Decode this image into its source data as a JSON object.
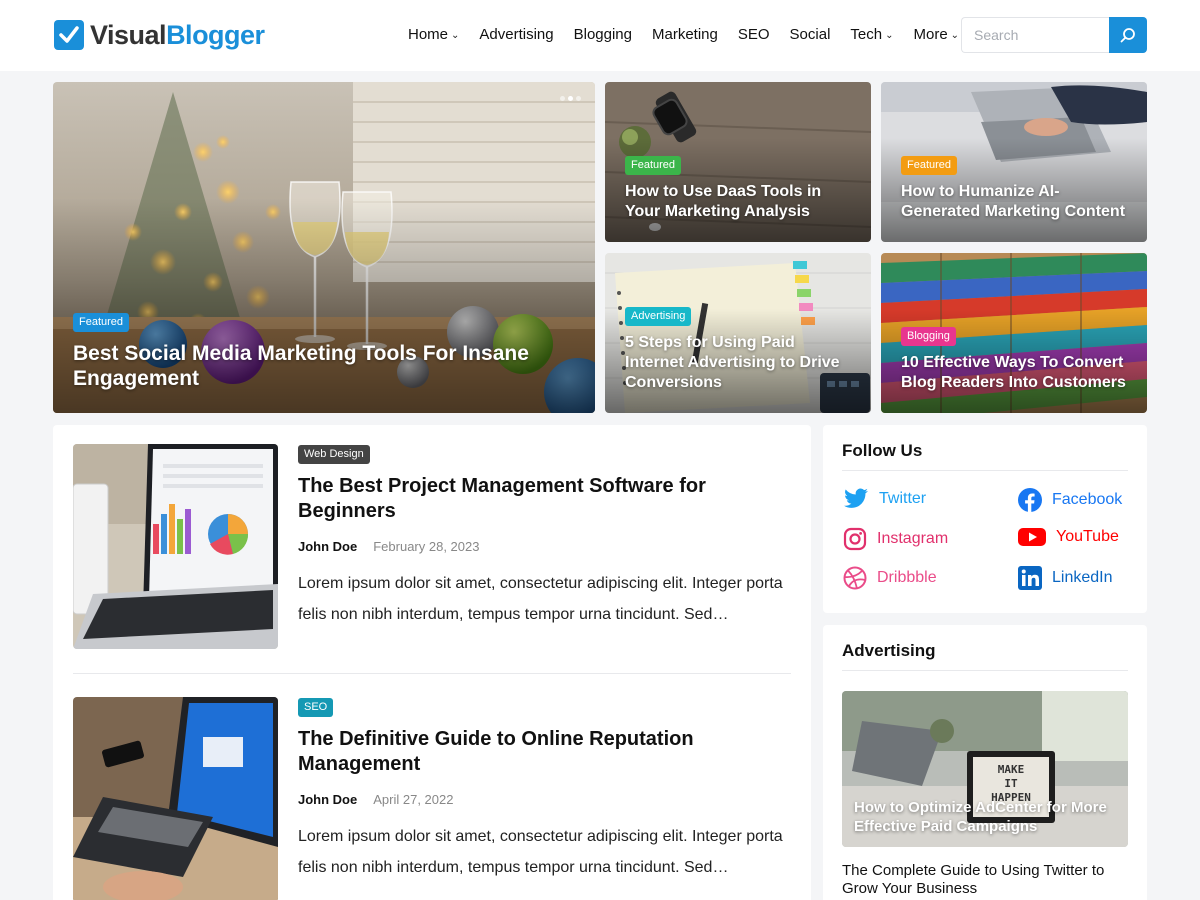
{
  "site": {
    "logo_part1": "Visual",
    "logo_part2": "Blogger",
    "brand_color": "#1a8fd9"
  },
  "nav": {
    "items": [
      {
        "label": "Home",
        "has_dropdown": true
      },
      {
        "label": "Advertising",
        "has_dropdown": false
      },
      {
        "label": "Blogging",
        "has_dropdown": false
      },
      {
        "label": "Marketing",
        "has_dropdown": false
      },
      {
        "label": "SEO",
        "has_dropdown": false
      },
      {
        "label": "Social",
        "has_dropdown": false
      },
      {
        "label": "Tech",
        "has_dropdown": true
      },
      {
        "label": "More",
        "has_dropdown": true
      }
    ],
    "dropdown_glyph": "⌄"
  },
  "search": {
    "placeholder": "Search",
    "icon": "search-icon"
  },
  "featured": {
    "main": {
      "badge": "Featured",
      "badge_color": "#1a8fd9",
      "title": "Best Social Media Marketing Tools For Insane Engagement",
      "slider_active": 2,
      "slider_count": 3
    },
    "cards": [
      {
        "badge": "Featured",
        "badge_color": "#3bb54a",
        "title": "How to Use DaaS Tools in Your Marketing Analysis"
      },
      {
        "badge": "Featured",
        "badge_color": "#f39c12",
        "title": "How to Humanize AI-Generated Marketing Content"
      },
      {
        "badge": "Advertising",
        "badge_color": "#17b8c9",
        "title": "5 Steps for Using Paid Internet Advertising to Drive Conversions"
      },
      {
        "badge": "Blogging",
        "badge_color": "#e8368f",
        "title": "10 Effective Ways To Convert Blog Readers Into Customers"
      }
    ]
  },
  "posts": [
    {
      "category": "Web Design",
      "category_color": "#444444",
      "title": "The Best Project Management Software for Beginners",
      "author": "John Doe",
      "date": "February 28, 2023",
      "excerpt": "Lorem ipsum dolor sit amet, consectetur adipiscing elit. Integer porta felis non nibh interdum, tempus tempor urna tincidunt. Sed…"
    },
    {
      "category": "SEO",
      "category_color": "#1599b4",
      "title": "The Definitive Guide to Online Reputation Management",
      "author": "John Doe",
      "date": "April 27, 2022",
      "excerpt": "Lorem ipsum dolor sit amet, consectetur adipiscing elit. Integer porta felis non nibh interdum, tempus tempor urna tincidunt. Sed…"
    }
  ],
  "sidebar": {
    "follow": {
      "title": "Follow Us",
      "links": [
        {
          "name": "Twitter",
          "icon": "twitter-icon",
          "color": "#1da1f2"
        },
        {
          "name": "Facebook",
          "icon": "facebook-icon",
          "color": "#1877f2"
        },
        {
          "name": "Instagram",
          "icon": "instagram-icon",
          "color": "#e1306c"
        },
        {
          "name": "YouTube",
          "icon": "youtube-icon",
          "color": "#ff0000"
        },
        {
          "name": "Dribbble",
          "icon": "dribbble-icon",
          "color": "#ea4c89"
        },
        {
          "name": "LinkedIn",
          "icon": "linkedin-icon",
          "color": "#0a66c2"
        }
      ]
    },
    "advertising": {
      "title": "Advertising",
      "card_title": "How to Optimize AdCenter for More Effective Paid Campaigns",
      "sign_text": "MAKE IT HAPPEN",
      "link_title": "The Complete Guide to Using Twitter to Grow Your Business"
    }
  }
}
